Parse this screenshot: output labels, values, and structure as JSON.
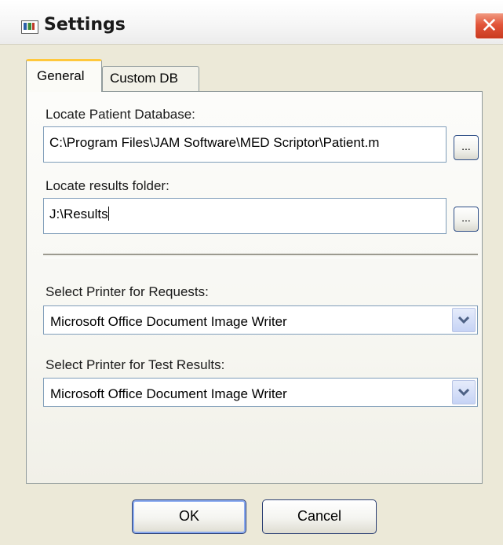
{
  "window": {
    "title": "Settings",
    "close_symbol": "✕"
  },
  "tabs": [
    {
      "label": "General",
      "active": true
    },
    {
      "label": "Custom DB",
      "active": false
    }
  ],
  "patient_db": {
    "label": "Locate Patient Database:",
    "value": "C:\\Program Files\\JAM Software\\MED Scriptor\\Patient.m",
    "browse_label": "..."
  },
  "results_folder": {
    "label": "Locate results folder:",
    "value": "J:\\Results",
    "browse_label": "..."
  },
  "printer_requests": {
    "label": "Select Printer for Requests:",
    "value": "Microsoft Office Document Image Writer"
  },
  "printer_results": {
    "label": "Select Printer for Test Results:",
    "value": "Microsoft Office Document Image Writer"
  },
  "buttons": {
    "ok": "OK",
    "cancel": "Cancel"
  }
}
